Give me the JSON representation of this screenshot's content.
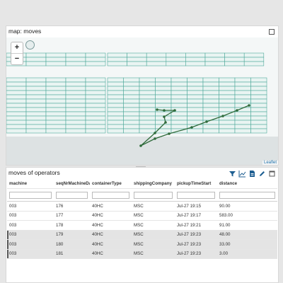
{
  "map_panel": {
    "title": "map: moves",
    "zoom_in": "+",
    "zoom_out": "−",
    "attribution": "Leaflet",
    "route_color": "#2f6b3b"
  },
  "table_panel": {
    "title": "moves of operators",
    "toolbar": [
      "filter-icon",
      "chart-icon",
      "document-icon",
      "edit-icon",
      "maximize-icon"
    ],
    "columns": [
      "machine",
      "seqNrMachineDay",
      "containerType",
      "shippingCompany",
      "pickupTimeStart",
      "distance"
    ],
    "rows": [
      {
        "machine": "003",
        "seq": "176",
        "type": "40HC",
        "company": "MSC",
        "pickup": "Jul-27 19:15",
        "distance": "90.00"
      },
      {
        "machine": "003",
        "seq": "177",
        "type": "40HC",
        "company": "MSC",
        "pickup": "Jul-27 19:17",
        "distance": "583.00"
      },
      {
        "machine": "003",
        "seq": "178",
        "type": "40HC",
        "company": "MSC",
        "pickup": "Jul-27 19:21",
        "distance": "91.00"
      },
      {
        "machine": "003",
        "seq": "179",
        "type": "40HC",
        "company": "MSC",
        "pickup": "Jul-27 19:23",
        "distance": "48.00"
      },
      {
        "machine": "003",
        "seq": "180",
        "type": "40HC",
        "company": "MSC",
        "pickup": "Jul-27 19:23",
        "distance": "33.00"
      },
      {
        "machine": "003",
        "seq": "181",
        "type": "40HC",
        "company": "MSC",
        "pickup": "Jul-27 19:23",
        "distance": "3.00"
      }
    ],
    "selected_rows": [
      3,
      4,
      5
    ]
  }
}
